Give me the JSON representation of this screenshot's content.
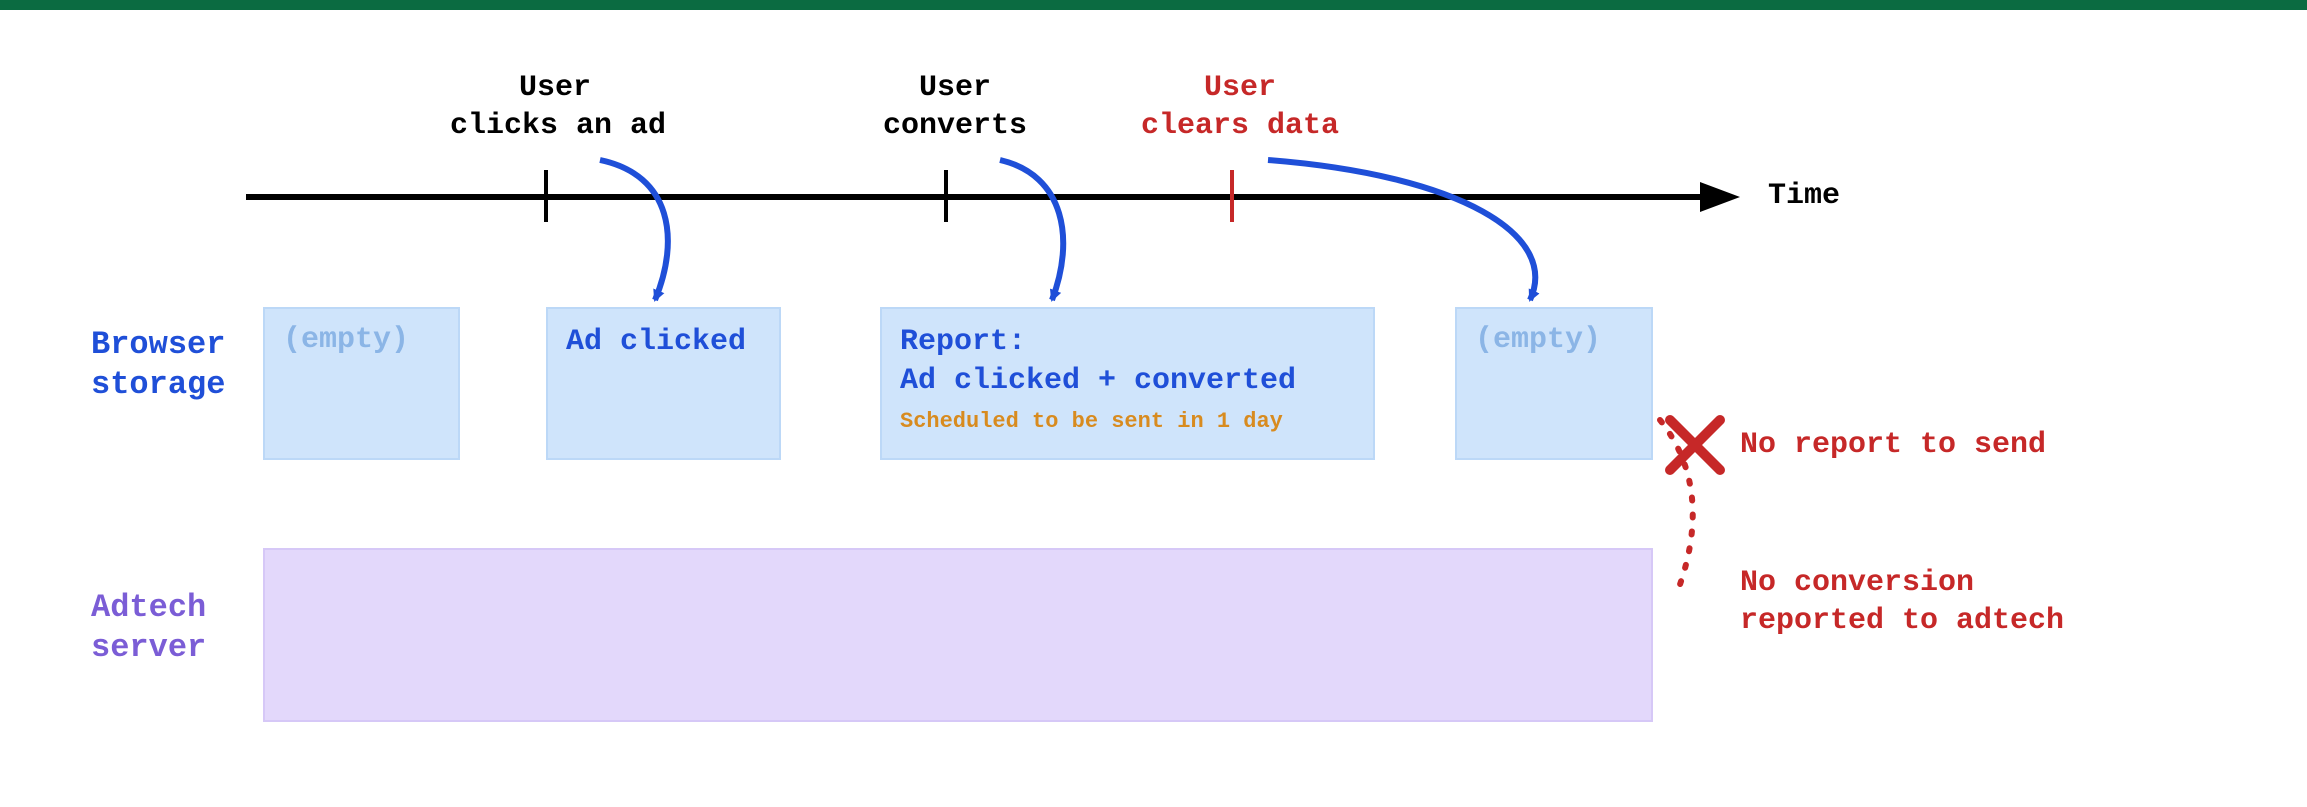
{
  "axis_label": "Time",
  "side_labels": {
    "browser_storage": "Browser\nstorage",
    "adtech_server": "Adtech\nserver"
  },
  "events": {
    "clicks_ad": "User\nclicks an ad",
    "converts": "User\nconverts",
    "clears_data": "User\nclears data"
  },
  "storage_states": {
    "empty1": "(empty)",
    "ad_clicked": "Ad clicked",
    "report_title": "Report:\nAd clicked + converted",
    "report_sub": "Scheduled to be sent in 1 day",
    "empty2": "(empty)"
  },
  "failure": {
    "no_report": "No report to send",
    "no_conversion": "No conversion\nreported to adtech"
  }
}
